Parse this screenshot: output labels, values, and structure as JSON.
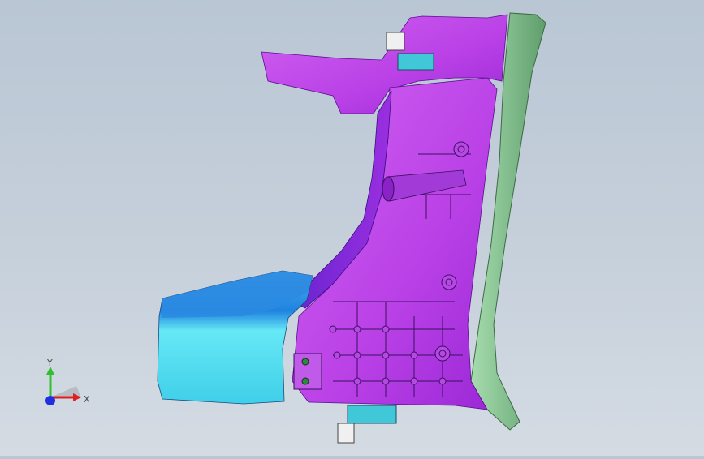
{
  "viewport": {
    "background_top": "#b9c6d4",
    "background_bottom": "#d4dbe3"
  },
  "model": {
    "name_icon": "car-body-part-model",
    "colors": {
      "magenta": "#c04ce8",
      "magenta_dark": "#8a1fc0",
      "purple": "#7a2ad8",
      "cyan": "#42d4f0",
      "blue": "#1e78d8",
      "green": "#8fd09a",
      "green_dark": "#5fa870"
    }
  },
  "triad": {
    "y_label": "Y",
    "x_label": "X",
    "y_color": "#2fbf2f",
    "x_color": "#e02020",
    "z_color": "#2030e0"
  }
}
